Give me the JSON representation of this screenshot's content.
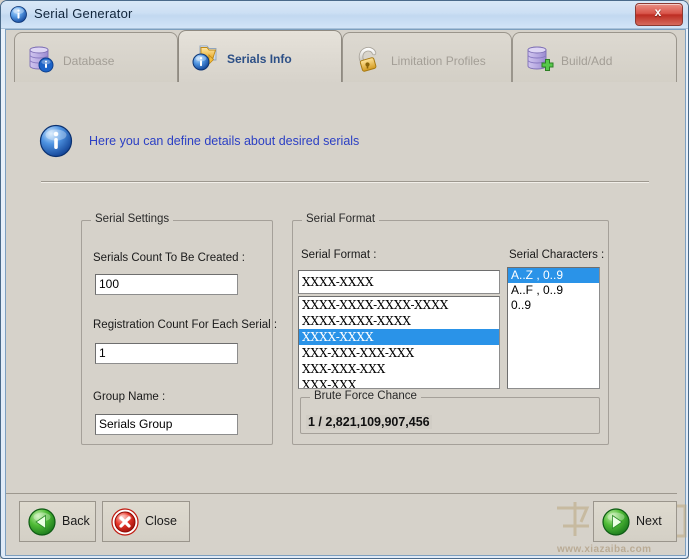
{
  "window": {
    "title": "Serial Generator",
    "title_icon": "info-circle-icon",
    "close_label": "x"
  },
  "tabs": [
    {
      "id": "database",
      "label": "Database",
      "icon": "database-info-icon",
      "active": false
    },
    {
      "id": "serials-info",
      "label": "Serials Info",
      "icon": "folder-info-icon",
      "active": true
    },
    {
      "id": "limitation",
      "label": "Limitation Profiles",
      "icon": "padlock-icon",
      "active": false
    },
    {
      "id": "build-add",
      "label": "Build/Add",
      "icon": "database-add-icon",
      "active": false
    }
  ],
  "banner": {
    "icon": "info-circle-icon",
    "text": "Here you can define details about desired serials"
  },
  "serial_settings": {
    "caption": "Serial Settings",
    "count_label": "Serials Count To Be Created :",
    "count_value": "100",
    "registration_label": "Registration Count For Each Serial :",
    "registration_value": "1",
    "group_name_label": "Group Name :",
    "group_name_value": "Serials Group"
  },
  "serial_format": {
    "caption": "Serial Format",
    "format_label": "Serial Format :",
    "format_value": "XXXX-XXXX",
    "format_options": [
      {
        "text": "XXXX-XXXX-XXXX-XXXX",
        "selected": false
      },
      {
        "text": "XXXX-XXXX-XXXX",
        "selected": false
      },
      {
        "text": "XXXX-XXXX",
        "selected": true
      },
      {
        "text": "XXX-XXX-XXX-XXX",
        "selected": false
      },
      {
        "text": "XXX-XXX-XXX",
        "selected": false
      },
      {
        "text": "XXX-XXX",
        "selected": false
      }
    ],
    "characters_label": "Serial Characters :",
    "characters_options": [
      {
        "text": "A..Z , 0..9",
        "selected": true
      },
      {
        "text": "A..F , 0..9",
        "selected": false
      },
      {
        "text": "0..9",
        "selected": false
      }
    ]
  },
  "brute_force": {
    "caption": "Brute Force Chance",
    "value": "1 / 2,821,109,907,456"
  },
  "footer": {
    "back_label": "Back",
    "back_icon": "green-left-arrow-icon",
    "close_label": "Close",
    "close_icon": "red-x-circle-icon",
    "next_label": "Next",
    "next_icon": "green-right-arrow-icon"
  },
  "watermark": {
    "url": "www.xiazaiba.com"
  },
  "colors": {
    "window_bg": "#d6d2ca",
    "title_blue": "#cde0f4",
    "accent_blue": "#2c4f86",
    "banner_text": "#2b3fc4",
    "selection": "#2a93e8",
    "close_red": "#bd2d22"
  }
}
